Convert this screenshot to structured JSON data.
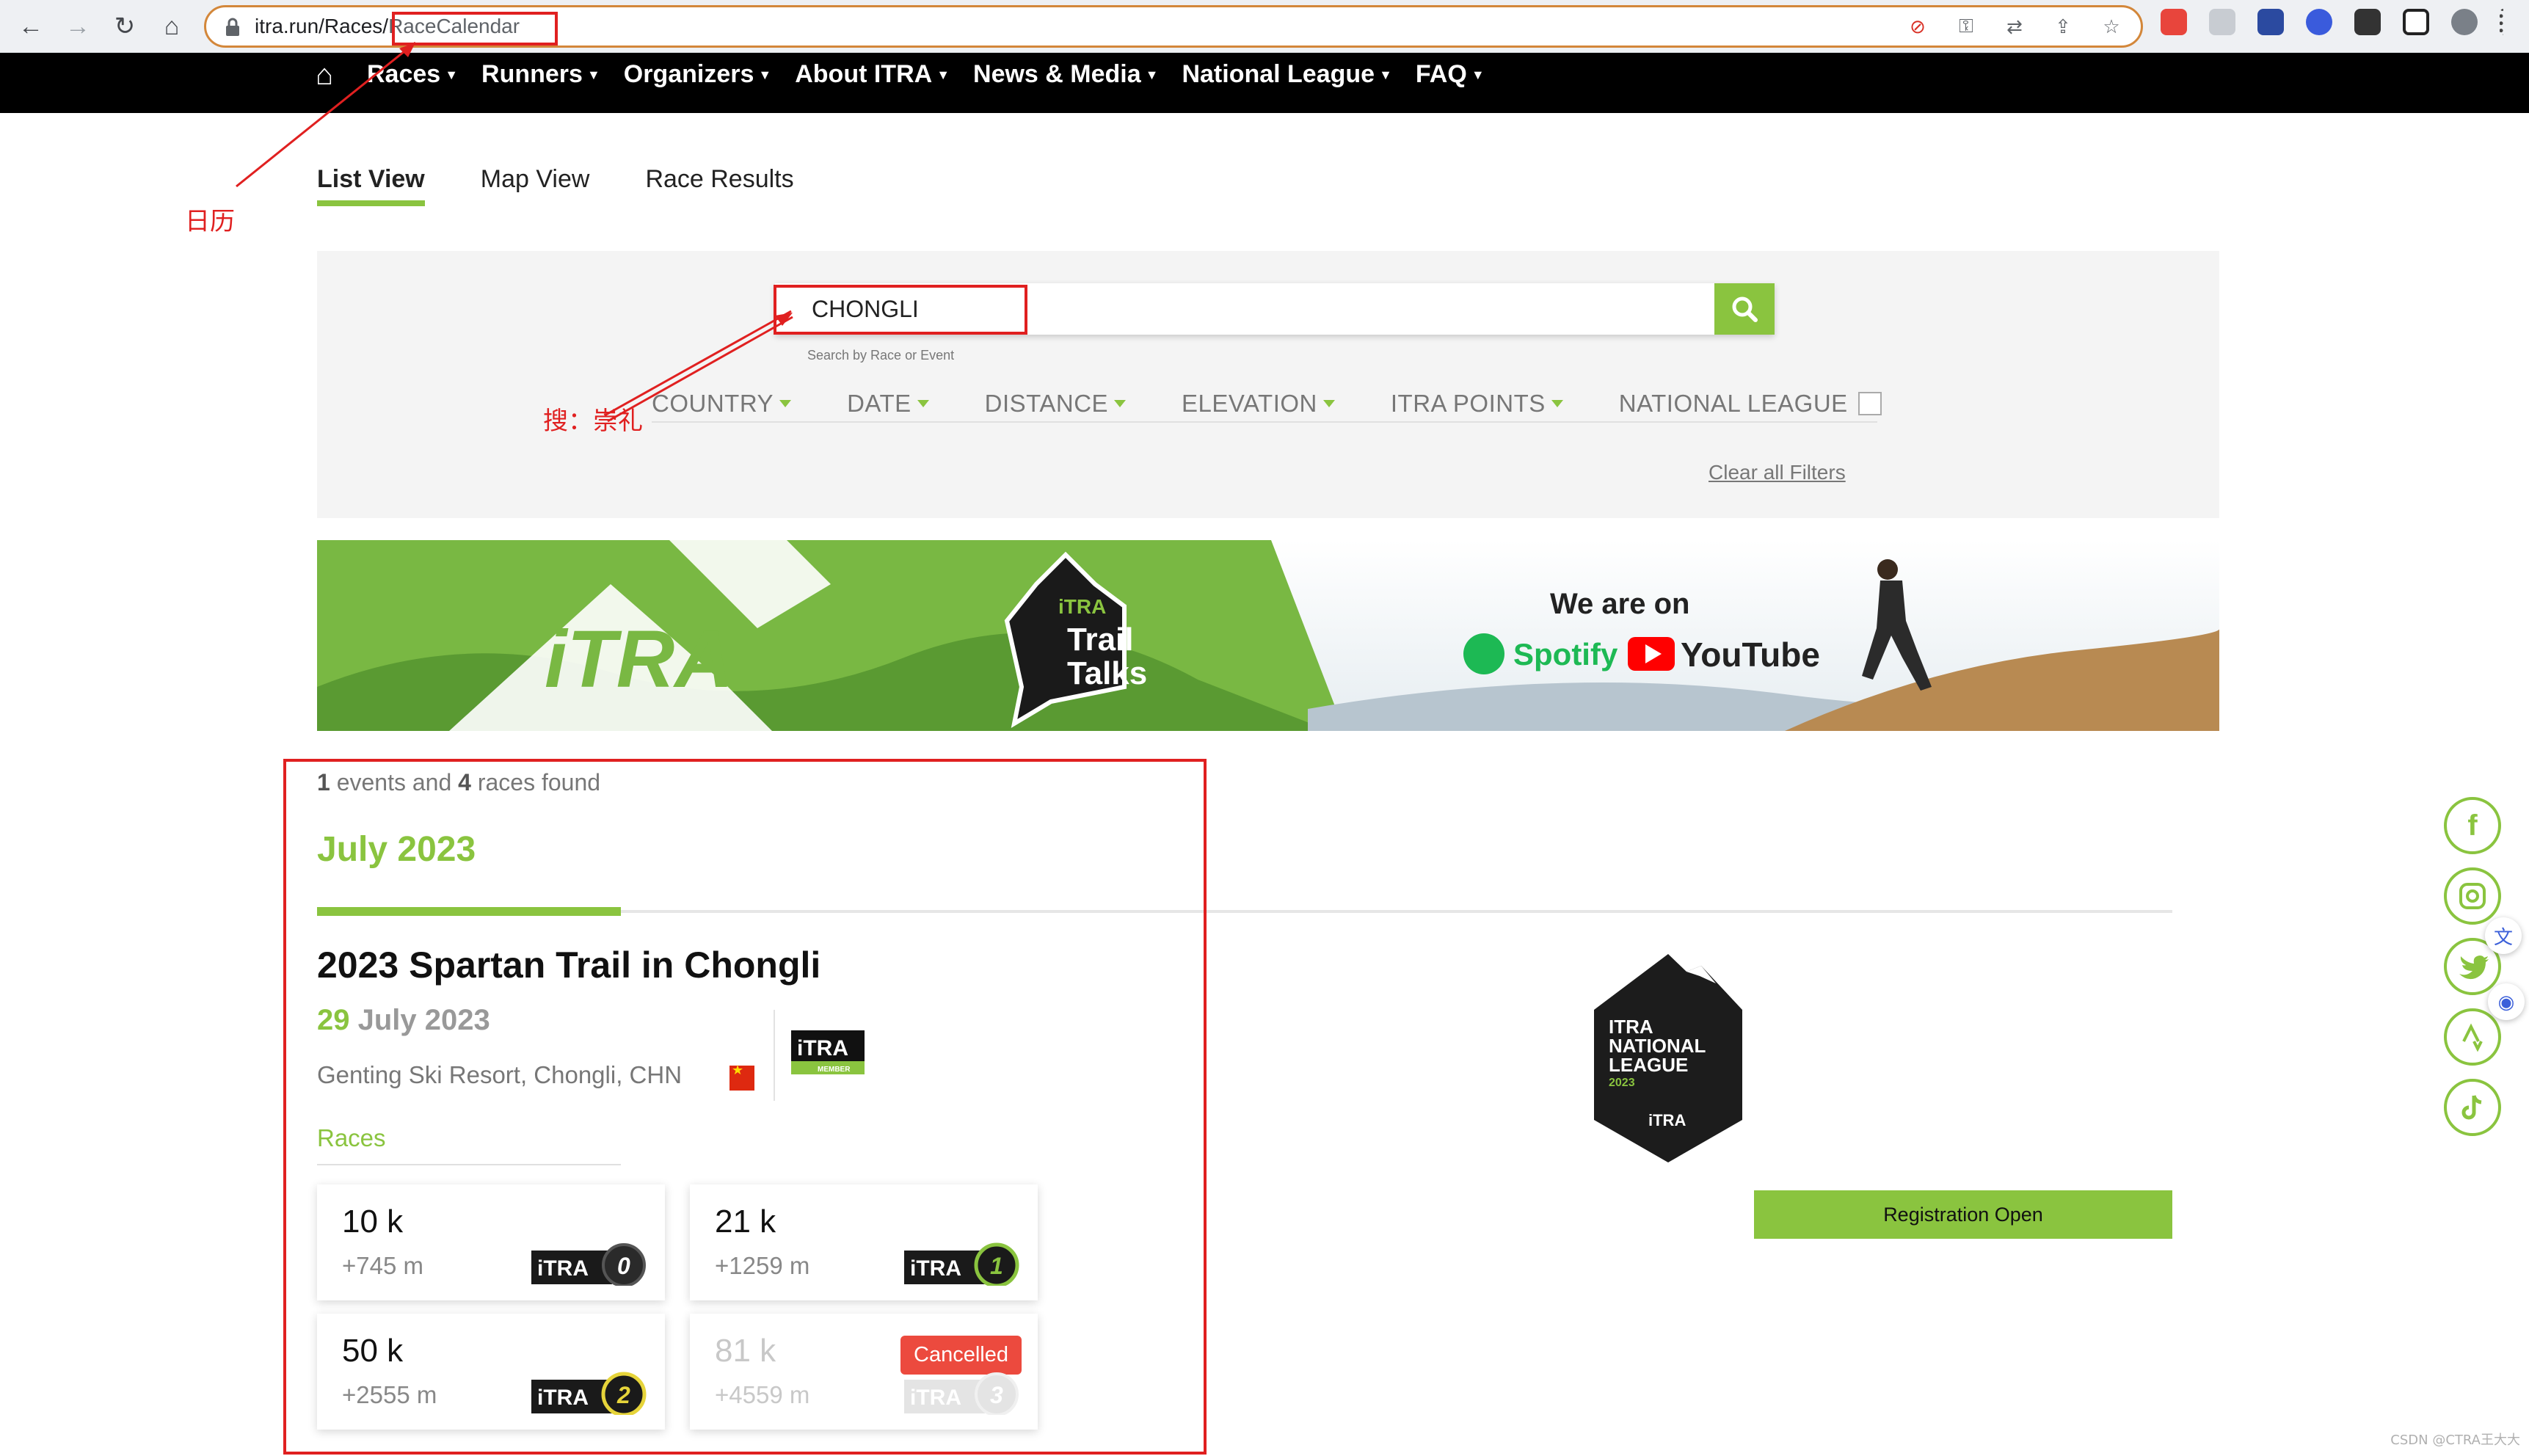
{
  "browser": {
    "url_host": "itra.run/Races/",
    "url_path": "RaceCalendar"
  },
  "site_nav": {
    "items": [
      {
        "label": "Races"
      },
      {
        "label": "Runners"
      },
      {
        "label": "Organizers"
      },
      {
        "label": "About ITRA"
      },
      {
        "label": "News & Media"
      },
      {
        "label": "National League"
      },
      {
        "label": "FAQ"
      }
    ]
  },
  "annotations": {
    "calendar_note": "日历",
    "search_note": "搜：崇礼"
  },
  "view_tabs": [
    {
      "label": "List View",
      "active": true
    },
    {
      "label": "Map View",
      "active": false
    },
    {
      "label": "Race Results",
      "active": false
    }
  ],
  "search": {
    "value": "CHONGLI",
    "hint": "Search by Race or Event"
  },
  "filters": [
    {
      "label": "COUNTRY"
    },
    {
      "label": "DATE"
    },
    {
      "label": "DISTANCE"
    },
    {
      "label": "ELEVATION"
    },
    {
      "label": "ITRA POINTS"
    }
  ],
  "national_league_filter": "NATIONAL LEAGUE",
  "clear_filters": "Clear all Filters",
  "banner": {
    "itra_logo": "iTRA",
    "trail_talks_brand": "iTRA",
    "trail_talks_1": "Trail",
    "trail_talks_2": "Talks",
    "we_are_on": "We are on",
    "spotify": "Spotify",
    "youtube": "YouTube"
  },
  "results": {
    "events_count": "1",
    "events_label": " events and ",
    "races_count": "4",
    "races_label": " races found",
    "month": "July 2023"
  },
  "event": {
    "title": "2023 Spartan Trail in Chongli",
    "date_day": "29",
    "date_rest": " July 2023",
    "location": "Genting Ski Resort, Chongli, CHN",
    "member_logo_text": "iTRA",
    "member_logo_sub": "MEMBER",
    "races_label": "Races",
    "races": [
      {
        "distance": "10 k",
        "elevation": "+745 m",
        "points": "0",
        "cancelled": false
      },
      {
        "distance": "21 k",
        "elevation": "+1259 m",
        "points": "1",
        "cancelled": false
      },
      {
        "distance": "50 k",
        "elevation": "+2555 m",
        "points": "2",
        "cancelled": false
      },
      {
        "distance": "81 k",
        "elevation": "+4559 m",
        "points": "3",
        "cancelled": true,
        "status": "Cancelled"
      }
    ],
    "badge_logo": "iTRA",
    "national_league_badge": {
      "line1": "ITRA",
      "line2": "NATIONAL",
      "line3": "LEAGUE",
      "year": "2023",
      "logo": "iTRA"
    },
    "registration": "Registration Open"
  },
  "social_icons": [
    "facebook-icon",
    "instagram-icon",
    "twitter-icon",
    "strava-icon",
    "tiktok-icon"
  ],
  "watermark": "CSDN @CTRA王大大",
  "colors": {
    "brand_green": "#8ac43f",
    "annotation_red": "#e02020",
    "cancelled_red": "#ec4a3e",
    "nav_black": "#000000"
  }
}
